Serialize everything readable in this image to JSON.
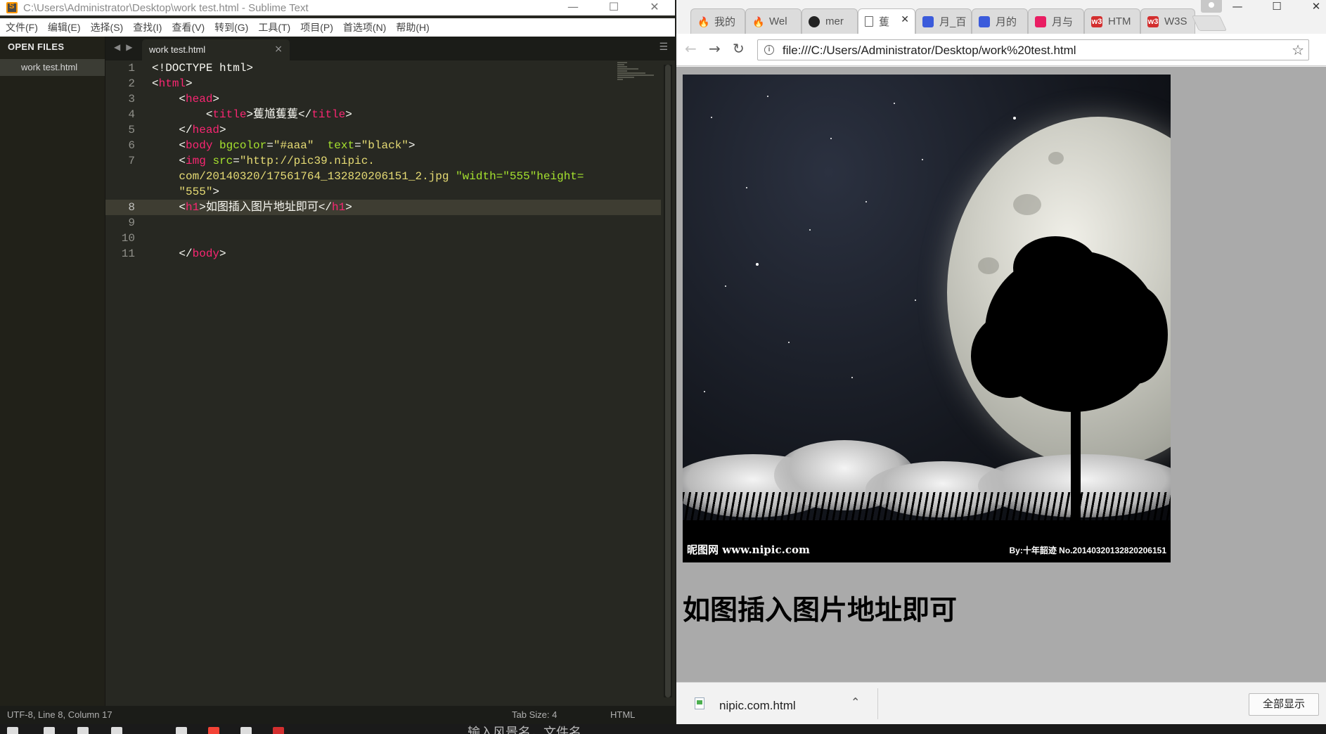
{
  "sublime": {
    "title": "C:\\Users\\Administrator\\Desktop\\work test.html - Sublime Text",
    "menu": [
      "文件(F)",
      "编辑(E)",
      "选择(S)",
      "查找(I)",
      "查看(V)",
      "转到(G)",
      "工具(T)",
      "项目(P)",
      "首选项(N)",
      "帮助(H)"
    ],
    "sidebar": {
      "header": "OPEN FILES",
      "file": "work test.html"
    },
    "tab": {
      "label": "work test.html",
      "close": "×"
    },
    "status": {
      "position": "UTF-8, Line 8, Column 17",
      "tab_size": "Tab Size: 4",
      "syntax": "HTML"
    },
    "line_numbers": [
      "1",
      "2",
      "3",
      "4",
      "5",
      "6",
      "7",
      "",
      "",
      "8",
      "9",
      "10",
      "11"
    ],
    "code": {
      "l1": "<!DOCTYPE html>",
      "l2_open": "<",
      "l2_tag": "html",
      "l2_close": ">",
      "l3_open": "<",
      "l3_tag": "head",
      "l3_close": ">",
      "l4_open": "<",
      "l4_tag": "title",
      "l4_text": ">蒦馗蒦蒦</",
      "l4_tag2": "title",
      "l4_close": ">",
      "l5_open": "</",
      "l5_tag": "head",
      "l5_close": ">",
      "l6_open": "<",
      "l6_tag": "body",
      "l6_attr1": "bgcolor",
      "l6_eq1": "=",
      "l6_val1": "\"#aaa\"",
      "l6_attr2": "text",
      "l6_eq2": "=",
      "l6_val2": "\"black\"",
      "l6_close": ">",
      "l7_open": "<",
      "l7_tag": "img",
      "l7_attr": "src",
      "l7_eq": "=",
      "l7_val1": "\"http://pic39.nipic.",
      "l7b_val": "com/20140320/17561764_132820206151_2.jpg",
      "l7b_attr": "\"width=\"555\"height=",
      "l7c_val": "\"555\"",
      "l7c_close": ">",
      "l8_open": "<",
      "l8_tag": "h1",
      "l8_text": ">如图插入图片地址即可</",
      "l8_tag2": "h1",
      "l8_close": ">",
      "l11_open": "</",
      "l11_tag": "body",
      "l11_close": ">"
    }
  },
  "chrome": {
    "tabs": [
      {
        "label": "我的",
        "icon": "flame-icon",
        "color": "#f57c00"
      },
      {
        "label": "Wel",
        "icon": "flame-icon",
        "color": "#f57c00"
      },
      {
        "label": "mer",
        "icon": "github-icon",
        "color": "#222222"
      },
      {
        "label": "蒦",
        "icon": "document-icon",
        "color": "#666666",
        "active": true
      },
      {
        "label": "月_百",
        "icon": "baidu-icon",
        "color": "#3b5bdb"
      },
      {
        "label": "月的",
        "icon": "baidu-icon",
        "color": "#3b5bdb"
      },
      {
        "label": "月与",
        "icon": "nipic-icon",
        "color": "#e91e63"
      },
      {
        "label": "HTM",
        "icon": "w3-icon",
        "color": "#d32f2f"
      },
      {
        "label": "W3S",
        "icon": "w3-icon",
        "color": "#d32f2f"
      }
    ],
    "url": "file:///C:/Users/Administrator/Desktop/work%20test.html",
    "page": {
      "heading": "如图插入图片地址即可",
      "watermark_left": "昵图网 www.nipic.com",
      "watermark_right": "By:十年韶迹  No.20140320132820206151"
    },
    "downloads": {
      "file": "nipic.com.html",
      "show_all": "全部显示"
    }
  },
  "taskbar": {
    "text": "输入风景名，文件名"
  }
}
